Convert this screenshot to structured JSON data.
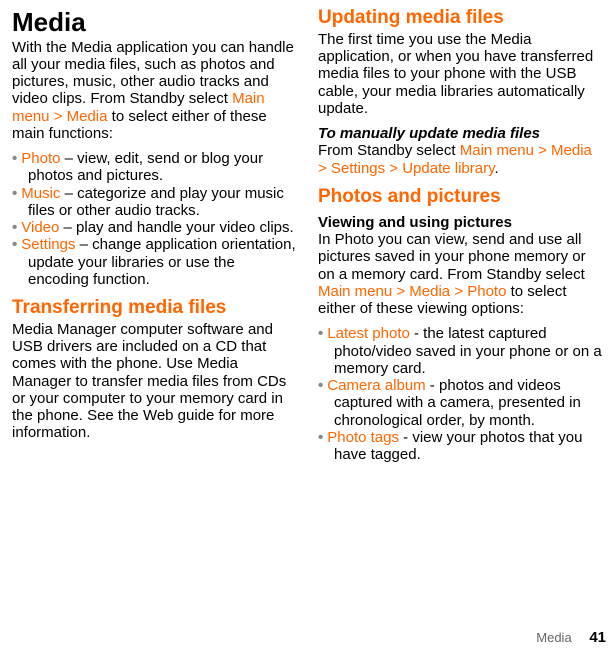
{
  "left": {
    "h1": "Media",
    "intro_a": "With the Media application you can handle all your media files, such as photos and pictures, music, other audio tracks and video clips. From Standby select ",
    "intro_accent": "Main menu > Media",
    "intro_b": " to select either of these main functions:",
    "items": [
      {
        "key": "Photo",
        "desc": " – view, edit, send or blog your photos and pictures."
      },
      {
        "key": "Music",
        "desc": " – categorize and play your music files or other audio tracks."
      },
      {
        "key": "Video",
        "desc": " – play and handle your video clips."
      },
      {
        "key": "Settings",
        "desc": " – change application orientation, update your libraries or use the encoding function."
      }
    ],
    "h2": "Transferring media files",
    "transfer": "Media Manager computer software and USB drivers are included on a CD that comes with the phone. Use Media Manager to transfer media files from CDs or your computer to your memory card in the phone. See the Web guide for more information."
  },
  "right": {
    "h2a": "Updating media files",
    "update": "The first time you use the Media application, or when you have transferred media files to your phone with the USB cable, your media libraries automatically update.",
    "sub_italic": "To manually update media files",
    "manual_a": "From Standby select ",
    "manual_accent": "Main menu > Media > Settings > Update library",
    "manual_b": ".",
    "h2b": "Photos and pictures",
    "sub": "Viewing and using pictures",
    "view_a": "In Photo you can view, send and use all pictures saved in your phone memory or on a memory card. From Standby select ",
    "view_accent": "Main menu > Media > Photo",
    "view_b": " to select either of these viewing options:",
    "items": [
      {
        "key": "Latest photo",
        "desc": " - the latest captured photo/video saved in your phone or on a memory card."
      },
      {
        "key": "Camera album",
        "desc": " - photos and videos captured with a camera, presented in chronological order, by month."
      },
      {
        "key": "Photo tags",
        "desc": " - view your photos that you have tagged."
      }
    ]
  },
  "footer": {
    "section": "Media",
    "page": "41"
  }
}
